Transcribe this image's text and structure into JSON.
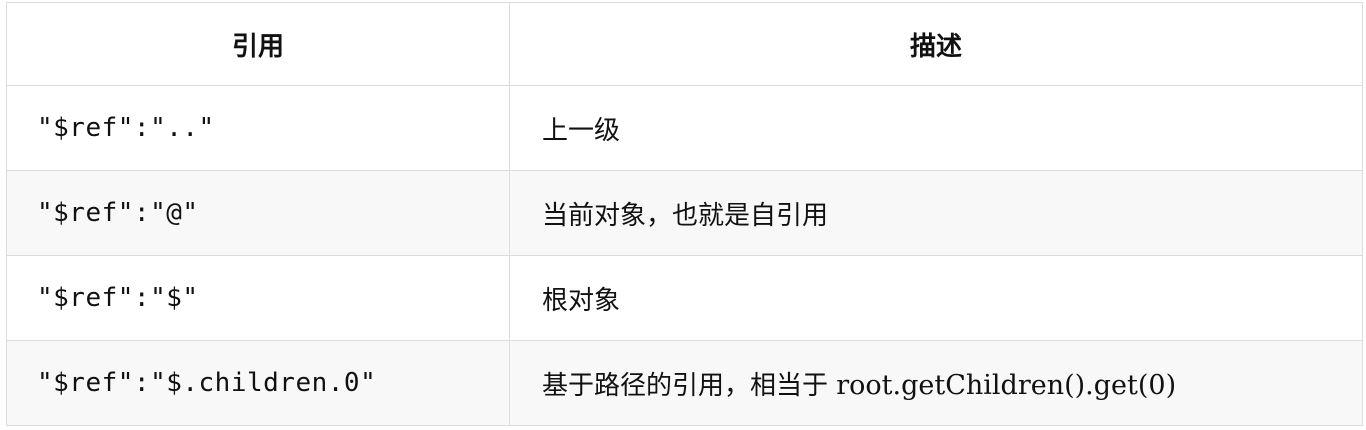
{
  "table": {
    "headers": [
      "引用",
      "描述"
    ],
    "rows": [
      {
        "ref": "\"$ref\":\"..\"",
        "desc": "上一级",
        "desc_suffix": ""
      },
      {
        "ref": "\"$ref\":\"@\"",
        "desc": "当前对象，也就是自引用",
        "desc_suffix": ""
      },
      {
        "ref": "\"$ref\":\"$\"",
        "desc": "根对象",
        "desc_suffix": ""
      },
      {
        "ref": "\"$ref\":\"$.children.0\"",
        "desc": "基于路径的引用，相当于 ",
        "desc_suffix": "root.getChildren().get(0)"
      }
    ]
  }
}
